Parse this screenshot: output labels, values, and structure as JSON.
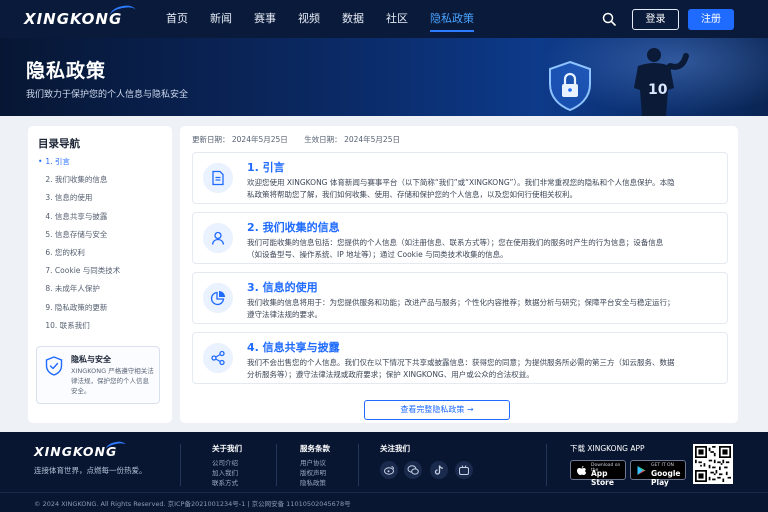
{
  "header": {
    "logo": "XINGKONG",
    "nav": [
      "首页",
      "新闻",
      "赛事",
      "视频",
      "数据",
      "社区",
      "隐私政策"
    ],
    "active_index": 6,
    "login": "登录",
    "register": "注册"
  },
  "banner": {
    "title": "隐私政策",
    "subtitle": "我们致力于保护您的个人信息与隐私安全",
    "player_number": "10"
  },
  "sidebar": {
    "title": "目录导航",
    "items": [
      "1. 引言",
      "2. 我们收集的信息",
      "3. 信息的使用",
      "4. 信息共享与披露",
      "5. 信息存储与安全",
      "6. 您的权利",
      "7. Cookie 与同类技术",
      "8. 未成年人保护",
      "9. 隐私政策的更新",
      "10. 联系我们"
    ],
    "card": {
      "title": "隐私与安全",
      "text": "XINGKONG 严格遵守相关法律法规，保护您的个人信息安全。"
    }
  },
  "content": {
    "updated": "更新日期： 2024年5月25日",
    "effective": "生效日期： 2024年5月25日",
    "sections": [
      {
        "title": "1. 引言",
        "text": "欢迎您使用 XINGKONG 体育新闻与赛事平台（以下简称“我们”或“XINGKONG”）。我们非常重视您的隐私和个人信息保护。本隐私政策将帮助您了解，我们如何收集、使用、存储和保护您的个人信息，以及您如何行使相关权利。"
      },
      {
        "title": "2. 我们收集的信息",
        "text": "我们可能收集的信息包括：您提供的个人信息（如注册信息、联系方式等）；您在使用我们的服务时产生的行为信息；设备信息（如设备型号、操作系统、IP 地址等）；通过 Cookie 与同类技术收集的信息。"
      },
      {
        "title": "3. 信息的使用",
        "text": "我们收集的信息将用于：为您提供服务和功能；改进产品与服务；个性化内容推荐；数据分析与研究；保障平台安全与稳定运行；遵守法律法规的要求。"
      },
      {
        "title": "4. 信息共享与披露",
        "text": "我们不会出售您的个人信息。我们仅在以下情况下共享或披露信息：获得您的同意；为提供服务所必需的第三方（如云服务、数据分析服务等）；遵守法律法规或政府要求；保护 XINGKONG、用户或公众的合法权益。"
      }
    ],
    "view_full": "查看完整隐私政策"
  },
  "footer": {
    "logo": "XINGKONG",
    "slogan": "连接体育世界，点燃每一份热爱。",
    "about_title": "关于我们",
    "about_links": [
      "公司介绍",
      "加入我们",
      "联系方式"
    ],
    "service_title": "服务条款",
    "service_links": [
      "用户协议",
      "版权声明",
      "隐私政策"
    ],
    "follow_title": "关注我们",
    "app_title": "下载 XINGKONG APP",
    "appstore_small": "Download on the",
    "appstore_big": "App Store",
    "gplay_small": "GET IT ON",
    "gplay_big": "Google Play",
    "copyright": "© 2024 XINGKONG. All Rights Reserved. 京ICP备2021001234号-1 | 京公网安备 11010502045678号"
  }
}
